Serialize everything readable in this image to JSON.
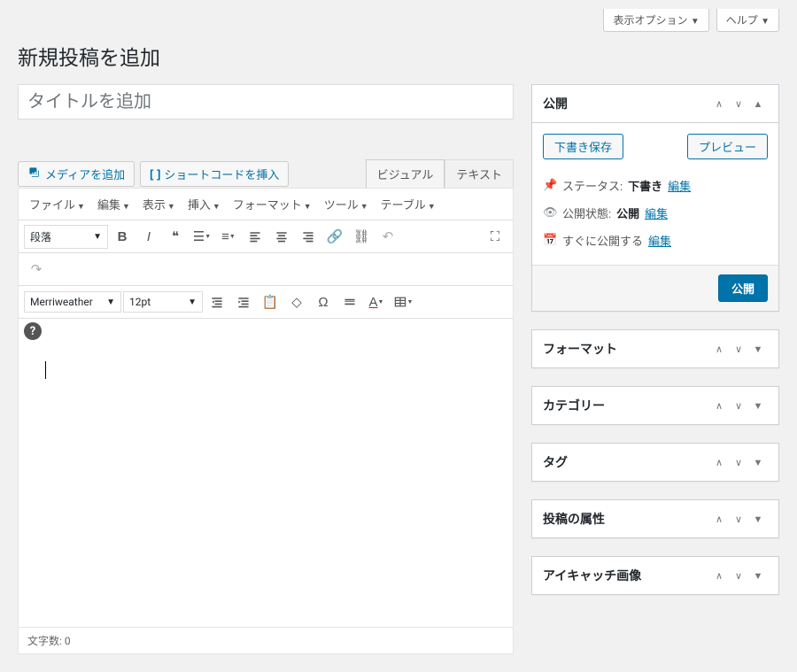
{
  "topbar": {
    "screen_options": "表示オプション",
    "help": "ヘルプ"
  },
  "page_title": "新規投稿を追加",
  "title_placeholder": "タイトルを追加",
  "media": {
    "add_media": "メディアを追加",
    "insert_shortcode": "ショートコードを挿入"
  },
  "editor_tabs": {
    "visual": "ビジュアル",
    "text": "テキスト"
  },
  "menubar": {
    "file": "ファイル",
    "edit": "編集",
    "view": "表示",
    "insert": "挿入",
    "format": "フォーマット",
    "tools": "ツール",
    "table": "テーブル"
  },
  "toolbar": {
    "format_select": "段落",
    "font_family": "Merriweather",
    "font_size": "12pt"
  },
  "statusbar": {
    "word_count_label": "文字数:",
    "word_count": "0"
  },
  "sidebar": {
    "publish": {
      "title": "公開",
      "save_draft": "下書き保存",
      "preview": "プレビュー",
      "status_label": "ステータス:",
      "status_value": "下書き",
      "visibility_label": "公開状態:",
      "visibility_value": "公開",
      "schedule_label": "すぐに公開する",
      "edit": "編集",
      "publish_btn": "公開"
    },
    "format": {
      "title": "フォーマット"
    },
    "categories": {
      "title": "カテゴリー"
    },
    "tags": {
      "title": "タグ"
    },
    "attributes": {
      "title": "投稿の属性"
    },
    "featured": {
      "title": "アイキャッチ画像"
    }
  }
}
